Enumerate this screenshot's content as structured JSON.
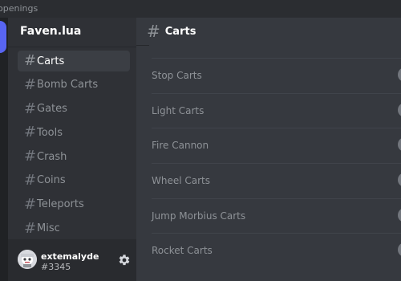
{
  "window": {
    "title_fragment": "openings"
  },
  "server": {
    "name": "Faven.lua"
  },
  "sidebar": {
    "channels": [
      {
        "label": "Carts",
        "active": true
      },
      {
        "label": "Bomb Carts",
        "active": false
      },
      {
        "label": "Gates",
        "active": false
      },
      {
        "label": "Tools",
        "active": false
      },
      {
        "label": "Crash",
        "active": false
      },
      {
        "label": "Coins",
        "active": false
      },
      {
        "label": "Teleports",
        "active": false
      },
      {
        "label": "Misc",
        "active": false
      }
    ],
    "hash_symbol": "#"
  },
  "user": {
    "name": "extemalyde",
    "tag": "#3345"
  },
  "main": {
    "header": {
      "hash_symbol": "#",
      "title": "Carts"
    },
    "items": [
      {
        "label": "Stop Carts"
      },
      {
        "label": "Light Carts"
      },
      {
        "label": "Fire Cannon"
      },
      {
        "label": "Wheel Carts"
      },
      {
        "label": "Jump Morbius Carts"
      },
      {
        "label": "Rocket Carts"
      }
    ]
  },
  "colors": {
    "background": "#36393f",
    "sidebar": "#2f3136",
    "active_channel": "#3b3e44",
    "accent": "#5865f2"
  },
  "icons": {
    "channel": "hash-icon",
    "settings": "gear-icon",
    "avatar": "avatar-icon",
    "toggle": "toggle-icon"
  }
}
